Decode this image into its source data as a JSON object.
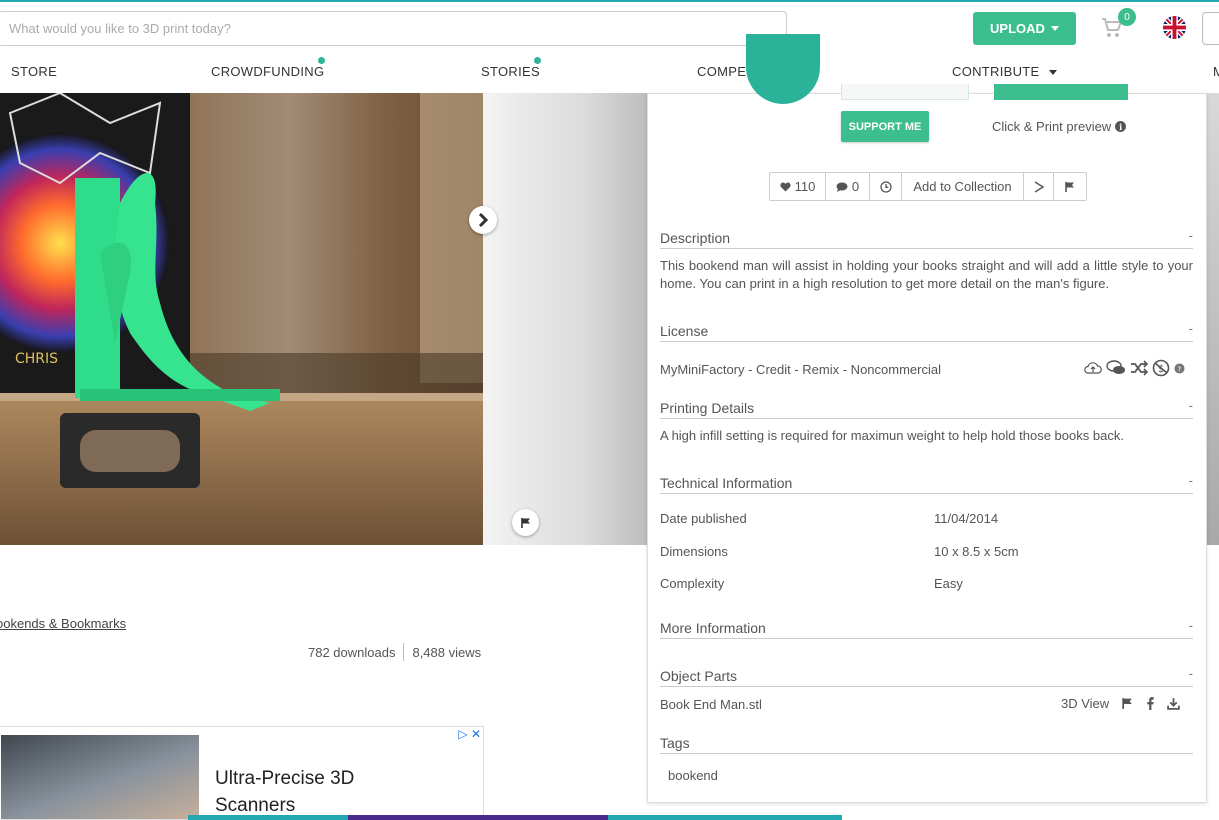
{
  "header": {
    "search_placeholder": "What would you like to 3D print today?",
    "upload_label": "UPLOAD",
    "cart_count": "0",
    "language": "English (UK flag)"
  },
  "nav": {
    "items": [
      {
        "label": "STORE",
        "dot": false
      },
      {
        "label": "CROWDFUNDING",
        "dot": true
      },
      {
        "label": "STORIES",
        "dot": true
      },
      {
        "label": "COMPETITIONS",
        "dot": false
      },
      {
        "label": "CONTRIBUTE",
        "dot": false,
        "dropdown": true
      },
      {
        "label": "M",
        "dot": false
      }
    ]
  },
  "object": {
    "category": "ookends & Bookmarks",
    "downloads": "782 downloads",
    "views": "8,488 views"
  },
  "ad": {
    "title": "Ultra-Precise 3D Scanners",
    "close": "▷ ✕"
  },
  "panel": {
    "support_label": "SUPPORT ME",
    "preview_label": "Click & Print preview",
    "actions": {
      "likes": "110",
      "comments": "0",
      "add_collection": "Add to Collection"
    },
    "description": {
      "heading": "Description",
      "collapse": "-",
      "text": "This bookend man will assist in holding your books straight and will add a little style to your home. You can print in a high resolution to get more detail on the man's figure."
    },
    "license": {
      "heading": "License",
      "collapse": "-",
      "text": "MyMiniFactory - Credit - Remix - Noncommercial"
    },
    "printing": {
      "heading": "Printing Details",
      "collapse": "-",
      "text": "A high infill setting is required for maximun weight to help hold those books back."
    },
    "technical": {
      "heading": "Technical Information",
      "collapse": "-",
      "rows": [
        {
          "label": "Date published",
          "value": "11/04/2014"
        },
        {
          "label": "Dimensions",
          "value": "10 x 8.5 x 5cm"
        },
        {
          "label": "Complexity",
          "value": "Easy"
        }
      ]
    },
    "more_info": {
      "heading": "More Information",
      "collapse": "-"
    },
    "parts": {
      "heading": "Object Parts",
      "collapse": "-",
      "file": "Book End Man.stl",
      "view_label": "3D View"
    },
    "tags": {
      "heading": "Tags",
      "items": [
        "bookend"
      ]
    }
  },
  "colors": {
    "accent": "#3dbe8e",
    "topline": "#22a8b0"
  }
}
